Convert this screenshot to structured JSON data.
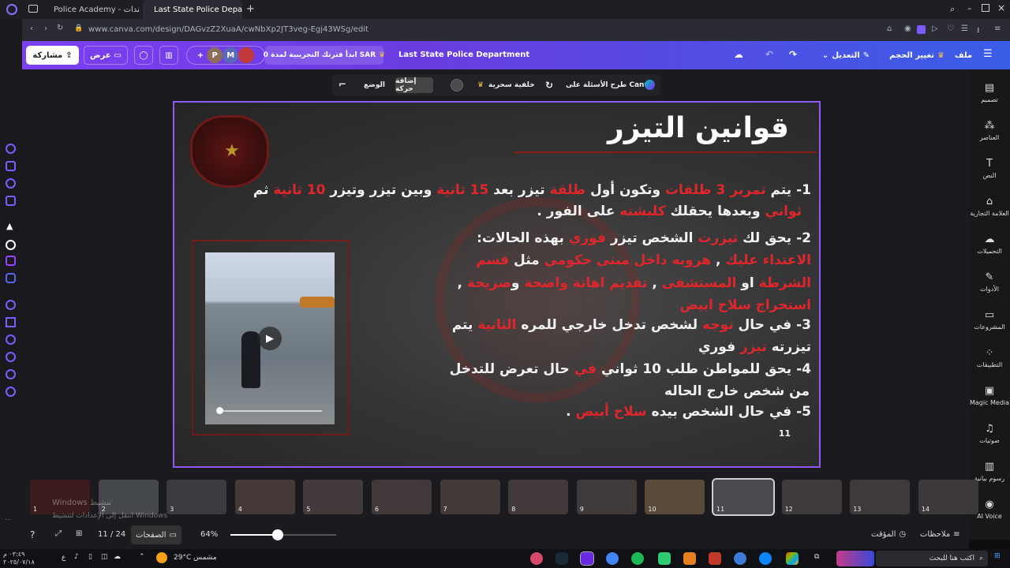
{
  "browser": {
    "tabs": [
      {
        "label": "Police Academy - مستندات"
      },
      {
        "label": "Last State Police Depart..."
      }
    ],
    "url": "www.canva.com/design/DAGvzZ2XuaA/cwNbXp2JT3veg-Egj43WSg/edit"
  },
  "header": {
    "file": "ملف",
    "resize": "تغيير الحجم",
    "edit": "التعديل",
    "doc_title": "Last State Police Department",
    "trial": "ابدأ فترتك التجريبية لمدة 0 SAR",
    "present": "عرض",
    "share": "مشاركة",
    "avatar_p": "P",
    "avatar_m": "M"
  },
  "context_toolbar": {
    "canva_ai": "طرح الأسئلة على Canva",
    "magic_bg": "خلفية سحرية",
    "add_animation": "إضافة حركة",
    "position": "الوضع"
  },
  "right_panel": [
    {
      "label": "تصميم",
      "icon": "layout-icon"
    },
    {
      "label": "العناصر",
      "icon": "elements-icon"
    },
    {
      "label": "النص",
      "icon": "text-icon"
    },
    {
      "label": "العلامة التجارية",
      "icon": "brand-icon"
    },
    {
      "label": "التحميلات",
      "icon": "upload-icon"
    },
    {
      "label": "الأدوات",
      "icon": "draw-icon"
    },
    {
      "label": "المشروعات",
      "icon": "folder-icon"
    },
    {
      "label": "التطبيقات",
      "icon": "apps-icon"
    },
    {
      "label": "Magic Media",
      "icon": "magic-media-icon"
    },
    {
      "label": "صوتيات",
      "icon": "audio-icon"
    },
    {
      "label": "رسوم بيانية",
      "icon": "chart-icon"
    },
    {
      "label": "AI Voice",
      "icon": "ai-voice-icon"
    }
  ],
  "slide": {
    "title": "قوانين التيزر",
    "logo_text": "LOS SANTOS POLICE DEPARTMENT",
    "page_number": "11",
    "lines": [
      [
        {
          "t": "1- يتم "
        },
        {
          "t": "تمرير 3 طلقات",
          "r": true
        },
        {
          "t": " وتكون أول "
        },
        {
          "t": "طلقة",
          "r": true
        },
        {
          "t": " تيزر بعد "
        },
        {
          "t": "15 ثانية",
          "r": true
        },
        {
          "t": " وبين تيزر وتيزر "
        },
        {
          "t": "10 ثانية",
          "r": true
        },
        {
          "t": " ثم"
        }
      ],
      [
        {
          "t": "ثواني",
          "r": true
        },
        {
          "t": " وبعدها يحقلك "
        },
        {
          "t": "كلبشته",
          "r": true
        },
        {
          "t": " على الفور ."
        }
      ],
      [
        {
          "t": "2- يحق لك "
        },
        {
          "t": "تيزرت",
          "r": true
        },
        {
          "t": " الشخص تيزر "
        },
        {
          "t": "فوري",
          "r": true
        },
        {
          "t": " بهذه الحالات:"
        }
      ],
      [
        {
          "t": "الاعتداء عليك",
          "r": true
        },
        {
          "t": " , "
        },
        {
          "t": "هروبه داخل مبنى حكومي",
          "r": true
        },
        {
          "t": " مثل "
        },
        {
          "t": "قسم",
          "r": true
        }
      ],
      [
        {
          "t": "الشرطة",
          "r": true
        },
        {
          "t": " او "
        },
        {
          "t": "المستشفى",
          "r": true
        },
        {
          "t": " , "
        },
        {
          "t": "تقديم اهانة واضحة",
          "r": true
        },
        {
          "t": " و"
        },
        {
          "t": "صريحة",
          "r": true
        },
        {
          "t": " ,"
        }
      ],
      [
        {
          "t": "استخراج سلاح ابيض",
          "r": true
        }
      ],
      [
        {
          "t": "3- في حال "
        },
        {
          "t": "توجه",
          "r": true
        },
        {
          "t": " لشخص تدخل خارجي للمره "
        },
        {
          "t": "الثانية",
          "r": true
        },
        {
          "t": " يتم"
        }
      ],
      [
        {
          "t": "تيزرته "
        },
        {
          "t": "تيزر",
          "r": true
        },
        {
          "t": " فوري"
        }
      ],
      [
        {
          "t": "4- يحق للمواطن طلب 10 ثواني "
        },
        {
          "t": "في",
          "r": true
        },
        {
          "t": " حال تعرض للتدخل"
        }
      ],
      [
        {
          "t": "من شخص خارج الحاله"
        }
      ],
      [
        {
          "t": "5- في حال الشخص بيده "
        },
        {
          "t": "سلاح أبيض",
          "r": true
        },
        {
          "t": " ."
        }
      ]
    ]
  },
  "thumbnails": [
    "1",
    "2",
    "3",
    "4",
    "5",
    "6",
    "7",
    "8",
    "9",
    "10",
    "11",
    "12",
    "13",
    "14"
  ],
  "watermark": {
    "line1": "Windows تنشيط",
    "line2": "انتقل إلى الإعدادات لتنشيط Windows"
  },
  "bottom_bar": {
    "zoom": "64%",
    "zoom_fraction": 0.45,
    "pages_label": "الصفحات",
    "page_counter": "11 / 24",
    "timer": "المؤقت",
    "notes": "ملاحظات"
  },
  "taskbar": {
    "weather": "29°C مشمس",
    "time": "٠٣:٤٩ م",
    "date": "٢٠٢٥/٠٧/١٨",
    "lang": "ع",
    "search_placeholder": "اكتب هنا للبحث"
  },
  "colors": {
    "accent": "#7b3ff2",
    "red_text": "#e0262c",
    "selection": "#8b5cf6"
  }
}
